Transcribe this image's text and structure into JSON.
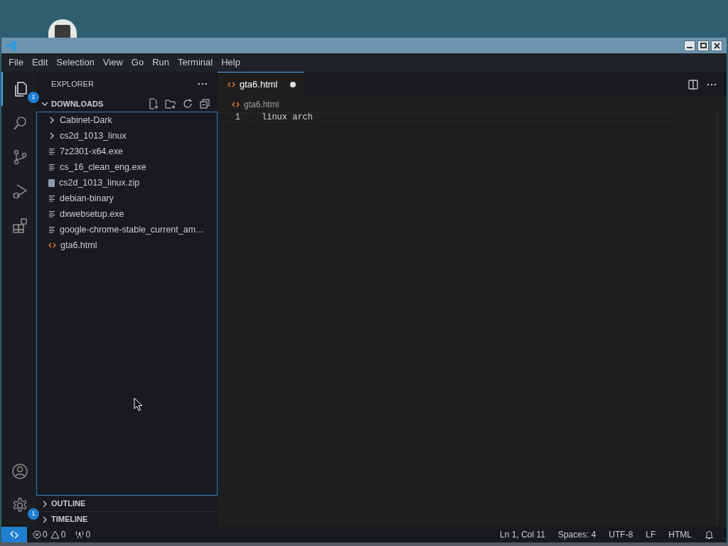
{
  "menu": [
    "File",
    "Edit",
    "Selection",
    "View",
    "Go",
    "Run",
    "Terminal",
    "Help"
  ],
  "activity_bar": {
    "items": [
      {
        "kind": "explorer",
        "selected": true,
        "badge": "1"
      },
      {
        "kind": "search",
        "selected": false
      },
      {
        "kind": "source-control",
        "selected": false
      },
      {
        "kind": "run-debug",
        "selected": false
      },
      {
        "kind": "extensions",
        "selected": false
      }
    ],
    "bottom": [
      {
        "kind": "account"
      },
      {
        "kind": "settings",
        "badge": "1"
      }
    ]
  },
  "sidebar": {
    "title": "EXPLORER",
    "section": {
      "title": "DOWNLOADS",
      "expanded": true,
      "items": [
        {
          "label": "Cabinet-Dark",
          "kind": "folder"
        },
        {
          "label": "cs2d_1013_linux",
          "kind": "folder"
        },
        {
          "label": "7z2301-x64.exe",
          "kind": "file"
        },
        {
          "label": "cs_16_clean_eng.exe",
          "kind": "file"
        },
        {
          "label": "cs2d_1013_linux.zip",
          "kind": "zip"
        },
        {
          "label": "debian-binary",
          "kind": "file"
        },
        {
          "label": "dxwebsetup.exe",
          "kind": "file"
        },
        {
          "label": "google-chrome-stable_current_am…",
          "kind": "file"
        },
        {
          "label": "gta6.html",
          "kind": "html"
        }
      ]
    },
    "panels": [
      {
        "title": "OUTLINE",
        "expanded": false
      },
      {
        "title": "TIMELINE",
        "expanded": false
      }
    ]
  },
  "editor": {
    "tabs": [
      {
        "label": "gta6.html",
        "selected": true,
        "modified": true
      }
    ],
    "breadcrumb": "gta6.html",
    "lines": [
      {
        "number": "1",
        "text": "linux arch"
      }
    ]
  },
  "status_bar": {
    "errors": "0",
    "warnings": "0",
    "ports": "0",
    "items": [
      "Ln 1, Col 11",
      "Spaces: 4",
      "UTF-8",
      "LF",
      "HTML"
    ]
  }
}
